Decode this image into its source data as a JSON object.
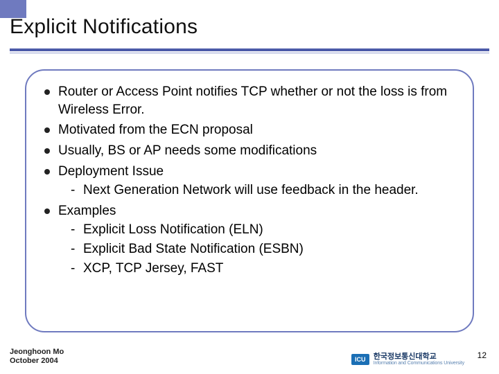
{
  "title": "Explicit Notifications",
  "bullets": {
    "b0": "Router or Access Point notifies TCP whether or not the loss is from Wireless Error.",
    "b1": "Motivated from the ECN proposal",
    "b2": "Usually, BS or AP needs some modifications",
    "b3": "Deployment Issue",
    "b3_sub0": "Next Generation Network will use feedback in the header.",
    "b4": "Examples",
    "b4_sub0": "Explicit Loss Notification (ELN)",
    "b4_sub1": "Explicit Bad State Notification (ESBN)",
    "b4_sub2": "XCP, TCP Jersey, FAST"
  },
  "footer": {
    "author": "Jeonghoon Mo",
    "date": "October 2004",
    "logo_badge": "ICU",
    "logo_korean": "한국정보통신대학교",
    "logo_english": "Information and Communications University"
  },
  "page_number": "12"
}
